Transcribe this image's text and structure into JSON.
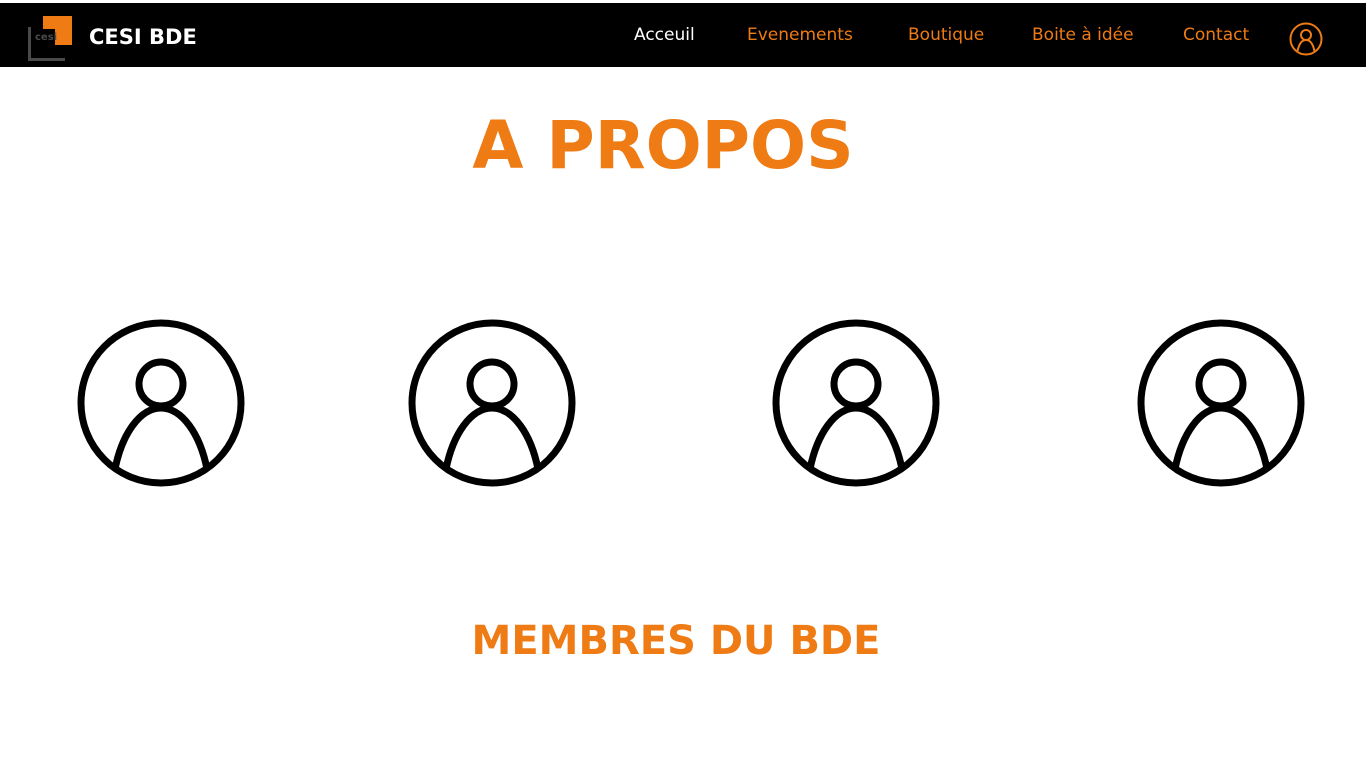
{
  "brand": {
    "logo_text": "cesi",
    "name": "CESI BDE"
  },
  "nav": {
    "items": [
      {
        "label": "Acceuil",
        "active": true
      },
      {
        "label": "Evenements",
        "active": false
      },
      {
        "label": "Boutique",
        "active": false
      },
      {
        "label": "Boite à idée",
        "active": false
      },
      {
        "label": "Contact",
        "active": false
      }
    ],
    "account_icon": "user-circle-icon"
  },
  "main": {
    "title": "A PROPOS",
    "members_count_visible": 4,
    "member_icon": "user-circle-icon",
    "section_title": "MEMBRES DU BDE"
  },
  "colors": {
    "accent": "#EE7B14",
    "nav_bar": "#000000",
    "background": "#FFFFFF",
    "active_nav": "#FFFFFF",
    "icon_stroke": "#000000"
  }
}
